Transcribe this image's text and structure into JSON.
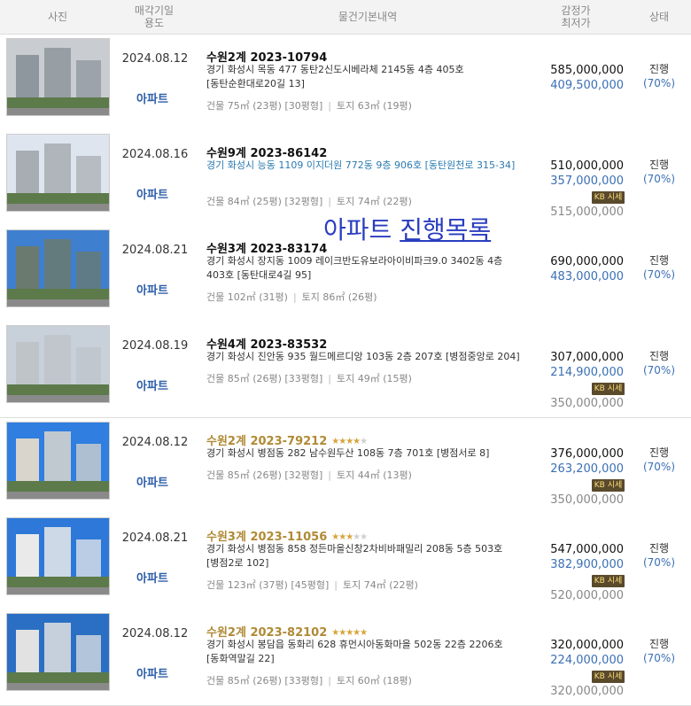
{
  "header": {
    "photo": "사진",
    "sale_date": "매각기일",
    "usage": "용도",
    "basic": "물건기본내역",
    "appraisal": "감정가",
    "min_price": "최저가",
    "status": "상태"
  },
  "overlay": {
    "part1": "아파트 ",
    "part2": "진행목록"
  },
  "sise_label": "시세",
  "rows": [
    {
      "date": "2024.08.12",
      "use": "아파트",
      "case": "수원2계 2023-10794",
      "stars": 0,
      "address": "경기 화성시 목동 477 동탄2신도시베라체 2145동 4층 405호 [동탄순환대로20길 13]",
      "area": "건물 75㎡ (23평) [30평형]",
      "land": "토지 63㎡ (19평)",
      "appraisal": "585,000,000",
      "min": "409,500,000",
      "market": "",
      "status": "진행",
      "pct": "(70%)"
    },
    {
      "date": "2024.08.16",
      "use": "아파트",
      "case": "수원9계 2023-86142",
      "stars": 0,
      "address": "경기 화성시 능동 1109 이지더원 772동 9층 906호 [동탄원천로 315-34]",
      "area": "건물 84㎡ (25평) [32평형]",
      "land": "토지 74㎡ (22평)",
      "appraisal": "510,000,000",
      "min": "357,000,000",
      "market": "515,000,000",
      "status": "진행",
      "pct": "(70%)"
    },
    {
      "date": "2024.08.21",
      "use": "아파트",
      "case": "수원3계 2023-83174",
      "stars": 0,
      "address": "경기 화성시 장지동 1009 레이크반도유보라아이비파크9.0 3402동 4층 403호 [동탄대로4길 95]",
      "area": "건물 102㎡ (31평)",
      "land": "토지 86㎡ (26평)",
      "appraisal": "690,000,000",
      "min": "483,000,000",
      "market": "",
      "status": "진행",
      "pct": "(70%)"
    },
    {
      "date": "2024.08.19",
      "use": "아파트",
      "case": "수원4계 2023-83532",
      "stars": 0,
      "address": "경기 화성시 진안동 935 월드메르디앙 103동 2층 207호 [병점중앙로 204]",
      "area": "건물 85㎡ (26평) [33평형]",
      "land": "토지 49㎡ (15평)",
      "appraisal": "307,000,000",
      "min": "214,900,000",
      "market": "350,000,000",
      "status": "진행",
      "pct": "(70%)"
    },
    {
      "date": "2024.08.12",
      "use": "아파트",
      "case": "수원2계 2023-79212",
      "stars": 4,
      "address": "경기 화성시 병점동 282 남수원두산 108동 7층 701호 [병점서로 8]",
      "area": "건물 85㎡ (26평) [32평형]",
      "land": "토지 44㎡ (13평)",
      "appraisal": "376,000,000",
      "min": "263,200,000",
      "market": "350,000,000",
      "status": "진행",
      "pct": "(70%)"
    },
    {
      "date": "2024.08.21",
      "use": "아파트",
      "case": "수원3계 2023-11056",
      "stars": 3,
      "address": "경기 화성시 병점동 858 정든마을신창2차비바패밀리 208동 5층 503호 [병점2로 102]",
      "area": "건물 123㎡ (37평) [45평형]",
      "land": "토지 74㎡ (22평)",
      "appraisal": "547,000,000",
      "min": "382,900,000",
      "market": "520,000,000",
      "status": "진행",
      "pct": "(70%)"
    },
    {
      "date": "2024.08.12",
      "use": "아파트",
      "case": "수원2계 2023-82102",
      "stars": 5,
      "address": "경기 화성시 봉담읍 동화리 628 휴먼시아동화마을 502동 22층 2206호 [동화역말길 22]",
      "area": "건물 85㎡ (26평) [33평형]",
      "land": "토지 60㎡ (18평)",
      "appraisal": "320,000,000",
      "min": "224,000,000",
      "market": "320,000,000",
      "status": "진행",
      "pct": "(70%)"
    }
  ]
}
